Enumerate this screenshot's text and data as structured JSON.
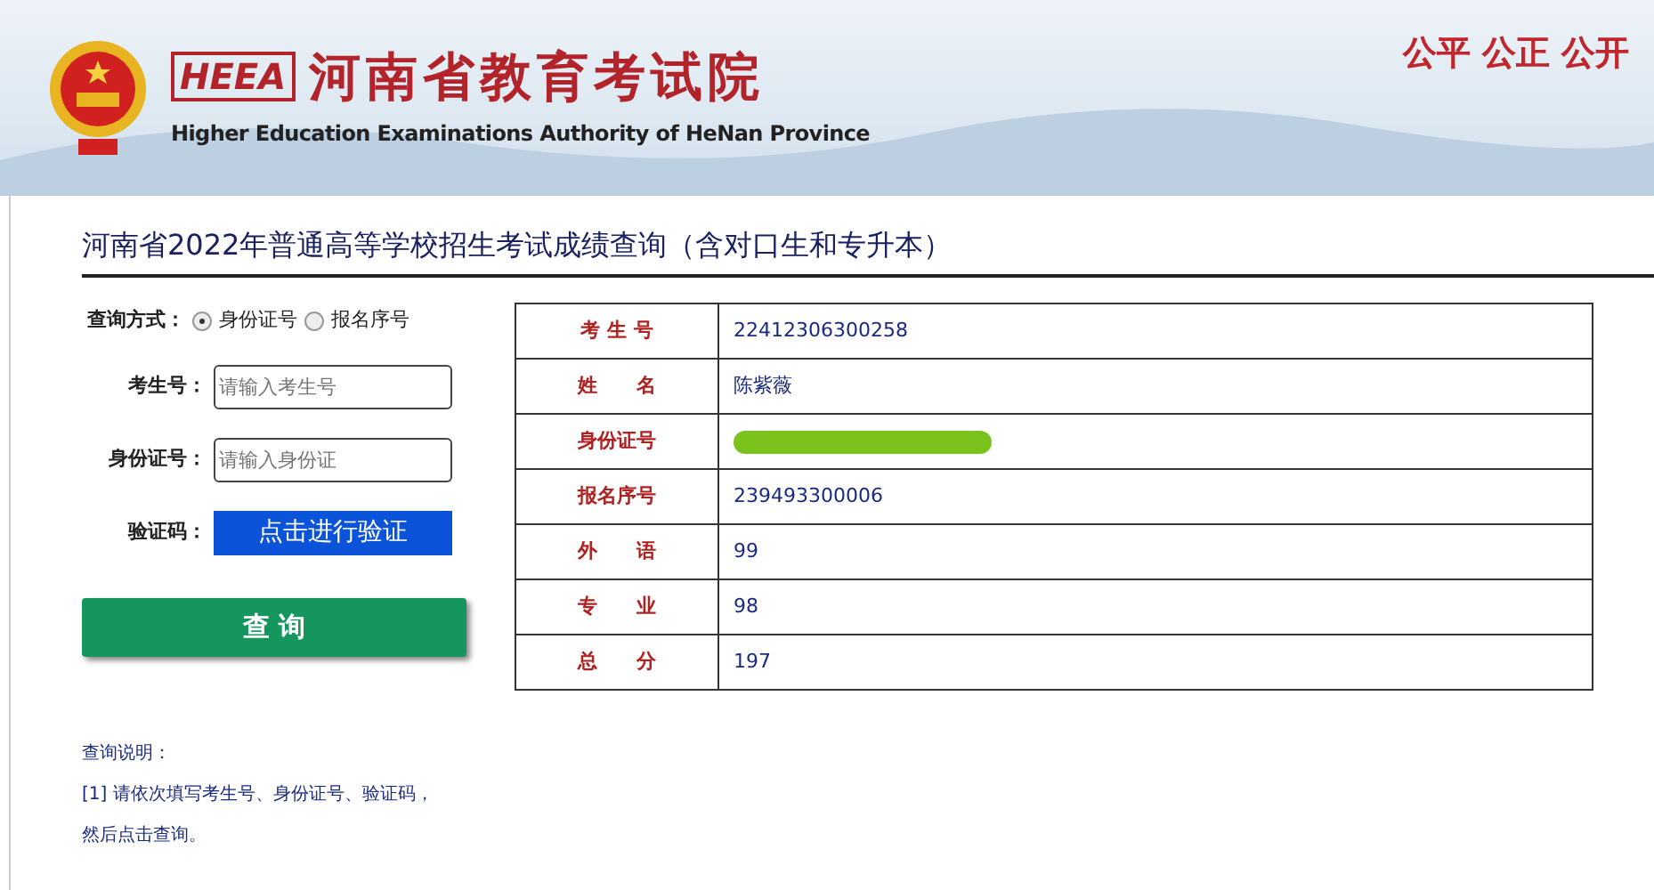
{
  "header": {
    "logo_text": "HEEA",
    "title": "河南省教育考试院",
    "subtitle": "Higher Education Examinations Authority of HeNan Province",
    "slogan": "公平 公正 公开"
  },
  "page_title": "河南省2022年普通高等学校招生考试成绩查询（含对口生和专升本）",
  "form": {
    "method_label": "查询方式：",
    "methods": [
      {
        "label": "身份证号",
        "selected": true
      },
      {
        "label": "报名序号",
        "selected": false
      }
    ],
    "fields": [
      {
        "label": "考生号：",
        "placeholder": "请输入考生号"
      },
      {
        "label": "身份证号：",
        "placeholder": "请输入身份证"
      }
    ],
    "captcha": {
      "label": "验证码：",
      "button": "点击进行验证"
    },
    "submit": "查 询"
  },
  "results": [
    {
      "kind": "text",
      "label": "考 生 号",
      "value": "22412306300258"
    },
    {
      "kind": "text",
      "label": "姓　　名",
      "value": "陈紫薇"
    },
    {
      "kind": "redacted",
      "label": "身份证号"
    },
    {
      "kind": "text",
      "label": "报名序号",
      "value": "239493300006"
    },
    {
      "kind": "text",
      "label": "外　　语",
      "value": "99"
    },
    {
      "kind": "text",
      "label": "专　　业",
      "value": "98"
    },
    {
      "kind": "text",
      "label": "总　　分",
      "value": "197"
    }
  ],
  "notes": {
    "title": "查询说明：",
    "lines": [
      "[1] 请依次填写考生号、身份证号、验证码，",
      "然后点击查询。"
    ]
  }
}
